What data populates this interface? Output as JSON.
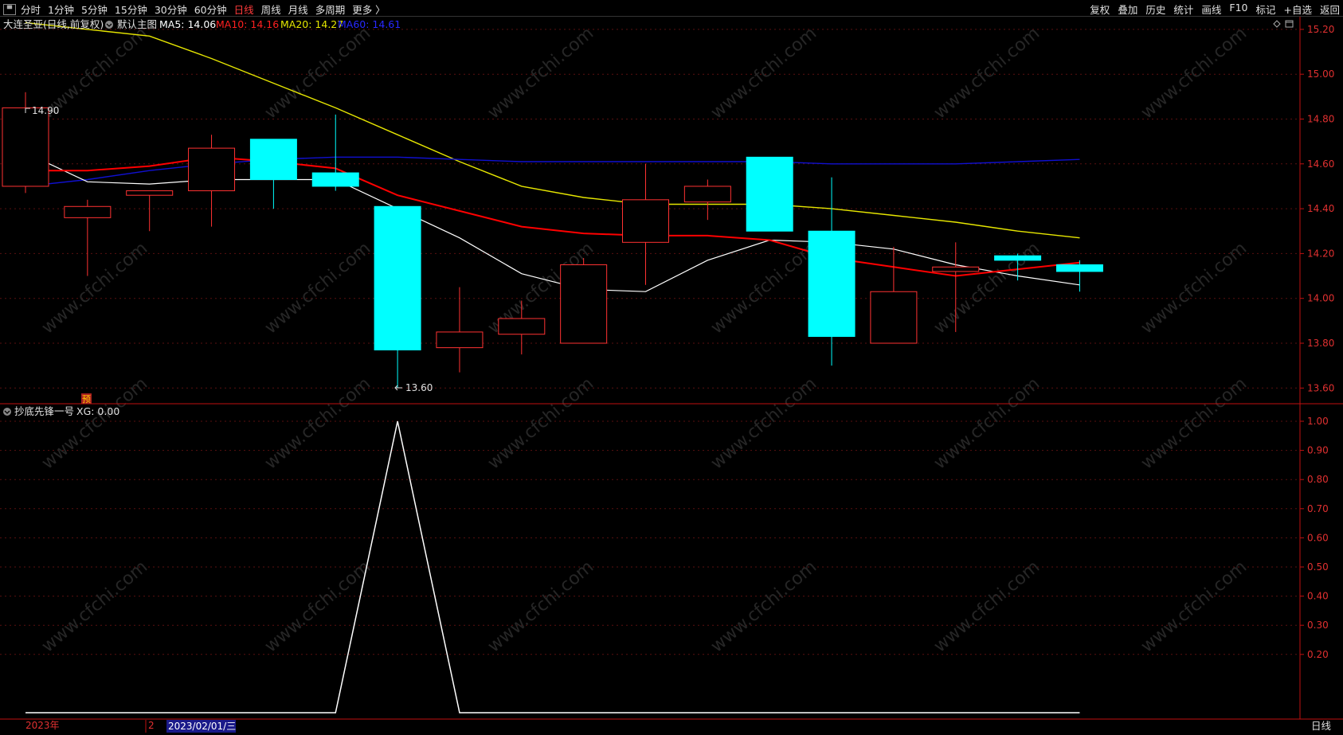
{
  "toolbar": {
    "system_icon": "window-icon",
    "periods": [
      "分时",
      "1分钟",
      "5分钟",
      "15分钟",
      "30分钟",
      "60分钟",
      "日线",
      "周线",
      "月线",
      "多周期",
      "更多 〉"
    ],
    "active_period": "日线",
    "right_buttons": [
      "复权",
      "叠加",
      "历史",
      "统计",
      "画线",
      "F10",
      "标记",
      "+自选",
      "返回"
    ]
  },
  "main_panel": {
    "title": "大连圣亚(日线,前复权)",
    "template": "默认主图",
    "ma5_label": "MA5: 14.06",
    "ma10_label": "MA10: 14.16",
    "ma20_label": "MA20: 14.27",
    "ma60_label": "MA60: 14.61",
    "high_marker": "14.90",
    "low_marker": "13.60",
    "badge": "预",
    "y_ticks": [
      "15.20",
      "15.00",
      "14.80",
      "14.60",
      "14.40",
      "14.20",
      "14.00",
      "13.80",
      "13.60"
    ]
  },
  "sub_panel": {
    "title": "抄底先锋一号",
    "value_label": "XG: 0.00",
    "y_ticks": [
      "1.00",
      "0.90",
      "0.80",
      "0.70",
      "0.60",
      "0.50",
      "0.40",
      "0.30",
      "0.20"
    ]
  },
  "footer": {
    "year_label": "2023年",
    "month_label": "2",
    "cursor_date": "2023/02/01/三",
    "period_label": "日线"
  },
  "watermark": "www.cfchi.com",
  "colors": {
    "up": "#ff3232",
    "down": "#00ffff",
    "ma5": "#ffffff",
    "ma10": "#ff0000",
    "ma20": "#e6e600",
    "ma60": "#1010d0",
    "axis": "#c01010",
    "label": "#e03030"
  },
  "chart_data": {
    "type": "candlestick",
    "title": "大连圣亚(日线,前复权)",
    "ylim": [
      13.53,
      15.26
    ],
    "candles": [
      {
        "o": 14.5,
        "h": 14.92,
        "l": 14.47,
        "c": 14.85
      },
      {
        "o": 14.36,
        "h": 14.44,
        "l": 14.1,
        "c": 14.41
      },
      {
        "o": 14.46,
        "h": 14.48,
        "l": 14.3,
        "c": 14.48
      },
      {
        "o": 14.48,
        "h": 14.73,
        "l": 14.32,
        "c": 14.67
      },
      {
        "o": 14.71,
        "h": 14.71,
        "l": 14.4,
        "c": 14.53
      },
      {
        "o": 14.56,
        "h": 14.82,
        "l": 14.48,
        "c": 14.5
      },
      {
        "o": 14.41,
        "h": 14.41,
        "l": 13.6,
        "c": 13.77
      },
      {
        "o": 13.78,
        "h": 14.05,
        "l": 13.67,
        "c": 13.85
      },
      {
        "o": 13.84,
        "h": 13.99,
        "l": 13.75,
        "c": 13.91
      },
      {
        "o": 13.8,
        "h": 14.18,
        "l": 13.8,
        "c": 14.15
      },
      {
        "o": 14.25,
        "h": 14.6,
        "l": 14.06,
        "c": 14.44
      },
      {
        "o": 14.43,
        "h": 14.53,
        "l": 14.35,
        "c": 14.5
      },
      {
        "o": 14.63,
        "h": 14.63,
        "l": 14.3,
        "c": 14.3
      },
      {
        "o": 14.3,
        "h": 14.54,
        "l": 13.7,
        "c": 13.83
      },
      {
        "o": 13.8,
        "h": 14.23,
        "l": 13.8,
        "c": 14.03
      },
      {
        "o": 14.12,
        "h": 14.25,
        "l": 13.85,
        "c": 14.14
      },
      {
        "o": 14.19,
        "h": 14.2,
        "l": 14.08,
        "c": 14.17
      },
      {
        "o": 14.15,
        "h": 14.17,
        "l": 14.03,
        "c": 14.12
      }
    ],
    "ma5": [
      14.65,
      14.52,
      14.51,
      14.53,
      14.53,
      14.53,
      14.4,
      14.27,
      14.11,
      14.04,
      14.03,
      14.17,
      14.26,
      14.25,
      14.22,
      14.15,
      14.1,
      14.06
    ],
    "ma10": [
      14.57,
      14.57,
      14.59,
      14.63,
      14.61,
      14.58,
      14.46,
      14.39,
      14.32,
      14.29,
      14.28,
      14.28,
      14.26,
      14.18,
      14.14,
      14.1,
      14.13,
      14.16
    ],
    "ma20": [
      15.23,
      15.2,
      15.17,
      15.07,
      14.96,
      14.85,
      14.73,
      14.61,
      14.5,
      14.45,
      14.42,
      14.42,
      14.42,
      14.4,
      14.37,
      14.34,
      14.3,
      14.27
    ],
    "ma60": [
      14.5,
      14.53,
      14.57,
      14.6,
      14.62,
      14.63,
      14.63,
      14.62,
      14.61,
      14.61,
      14.61,
      14.61,
      14.61,
      14.6,
      14.6,
      14.6,
      14.61,
      14.62
    ],
    "indicator": {
      "name": "抄底先锋一号",
      "series": "XG",
      "ylim": [
        0,
        1
      ],
      "values": [
        0,
        0,
        0,
        0,
        0,
        0,
        1,
        0,
        0,
        0,
        0,
        0,
        0,
        0,
        0,
        0,
        0,
        0
      ]
    }
  }
}
